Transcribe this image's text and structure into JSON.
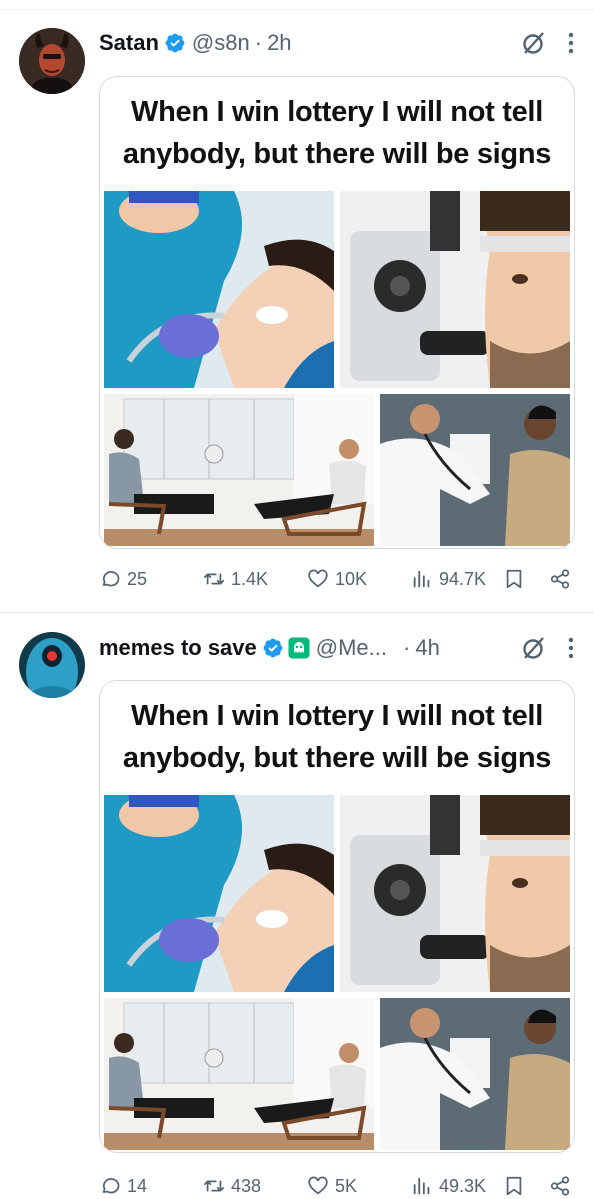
{
  "tweets": [
    {
      "name": "Satan",
      "handle": "@s8n",
      "separator": "·",
      "time": "2h",
      "meme_caption": "When I win lottery I will not tell anybody, but there will be signs",
      "replies": "25",
      "reposts": "1.4K",
      "likes": "10K",
      "views": "94.7K"
    },
    {
      "name": "memes to save",
      "handle": "@Me...",
      "separator": "·",
      "time": "4h",
      "meme_caption": "When I win lottery I will not tell anybody, but there will be signs",
      "replies": "14",
      "reposts": "438",
      "likes": "5K",
      "views": "49.3K"
    }
  ],
  "icons": {
    "verified": "verified-badge-icon",
    "affiliate": "ghost-affiliate-badge-icon",
    "grok": "grok-icon",
    "more": "more-vertical-icon",
    "reply": "reply-icon",
    "repost": "repost-icon",
    "like": "like-icon",
    "views": "views-icon",
    "bookmark": "bookmark-icon",
    "share": "share-icon"
  },
  "colors": {
    "verified": "#1d9bf0",
    "affiliate": "#00ba7c",
    "text_secondary": "#536471"
  }
}
